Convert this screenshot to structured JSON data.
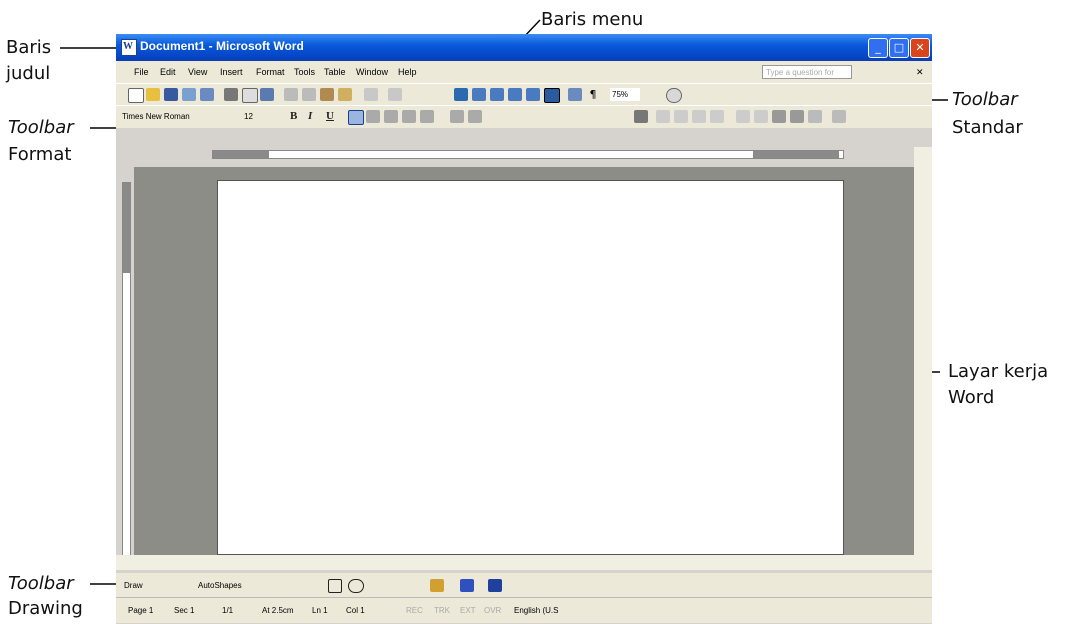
{
  "labels": {
    "baris_menu": "Baris menu",
    "baris_judul_1": "Baris",
    "baris_judul_2": "judul",
    "toolbar_standar_1": "Toolbar",
    "toolbar_standar_2": "Standar",
    "toolbar_format_1": "Toolbar",
    "toolbar_format_2": "Format",
    "layar_kerja_1": "Layar kerja",
    "layar_kerja_2": "Word",
    "toolbar_drawing_1": "Toolbar",
    "toolbar_drawing_2": "Drawing"
  },
  "window": {
    "title": "Document1 - Microsoft Word",
    "app_icon": "W",
    "menus": [
      "File",
      "Edit",
      "View",
      "Insert",
      "Format",
      "Tools",
      "Table",
      "Window",
      "Help"
    ],
    "help_placeholder": "Type a question for help"
  },
  "standard_toolbar": {
    "zoom": "75%"
  },
  "format_toolbar": {
    "font": "Times New Roman",
    "size": "12",
    "bold": "B",
    "italic": "I",
    "underline": "U"
  },
  "drawing_toolbar": {
    "draw": "Draw",
    "autoshapes": "AutoShapes"
  },
  "status_bar": {
    "page": "Page 1",
    "sec": "Sec 1",
    "pages": "1/1",
    "at": "At 2.5cm",
    "ln": "Ln 1",
    "col": "Col 1",
    "rec": "REC",
    "trk": "TRK",
    "ext": "EXT",
    "ovr": "OVR",
    "lang": "English (U.S"
  }
}
